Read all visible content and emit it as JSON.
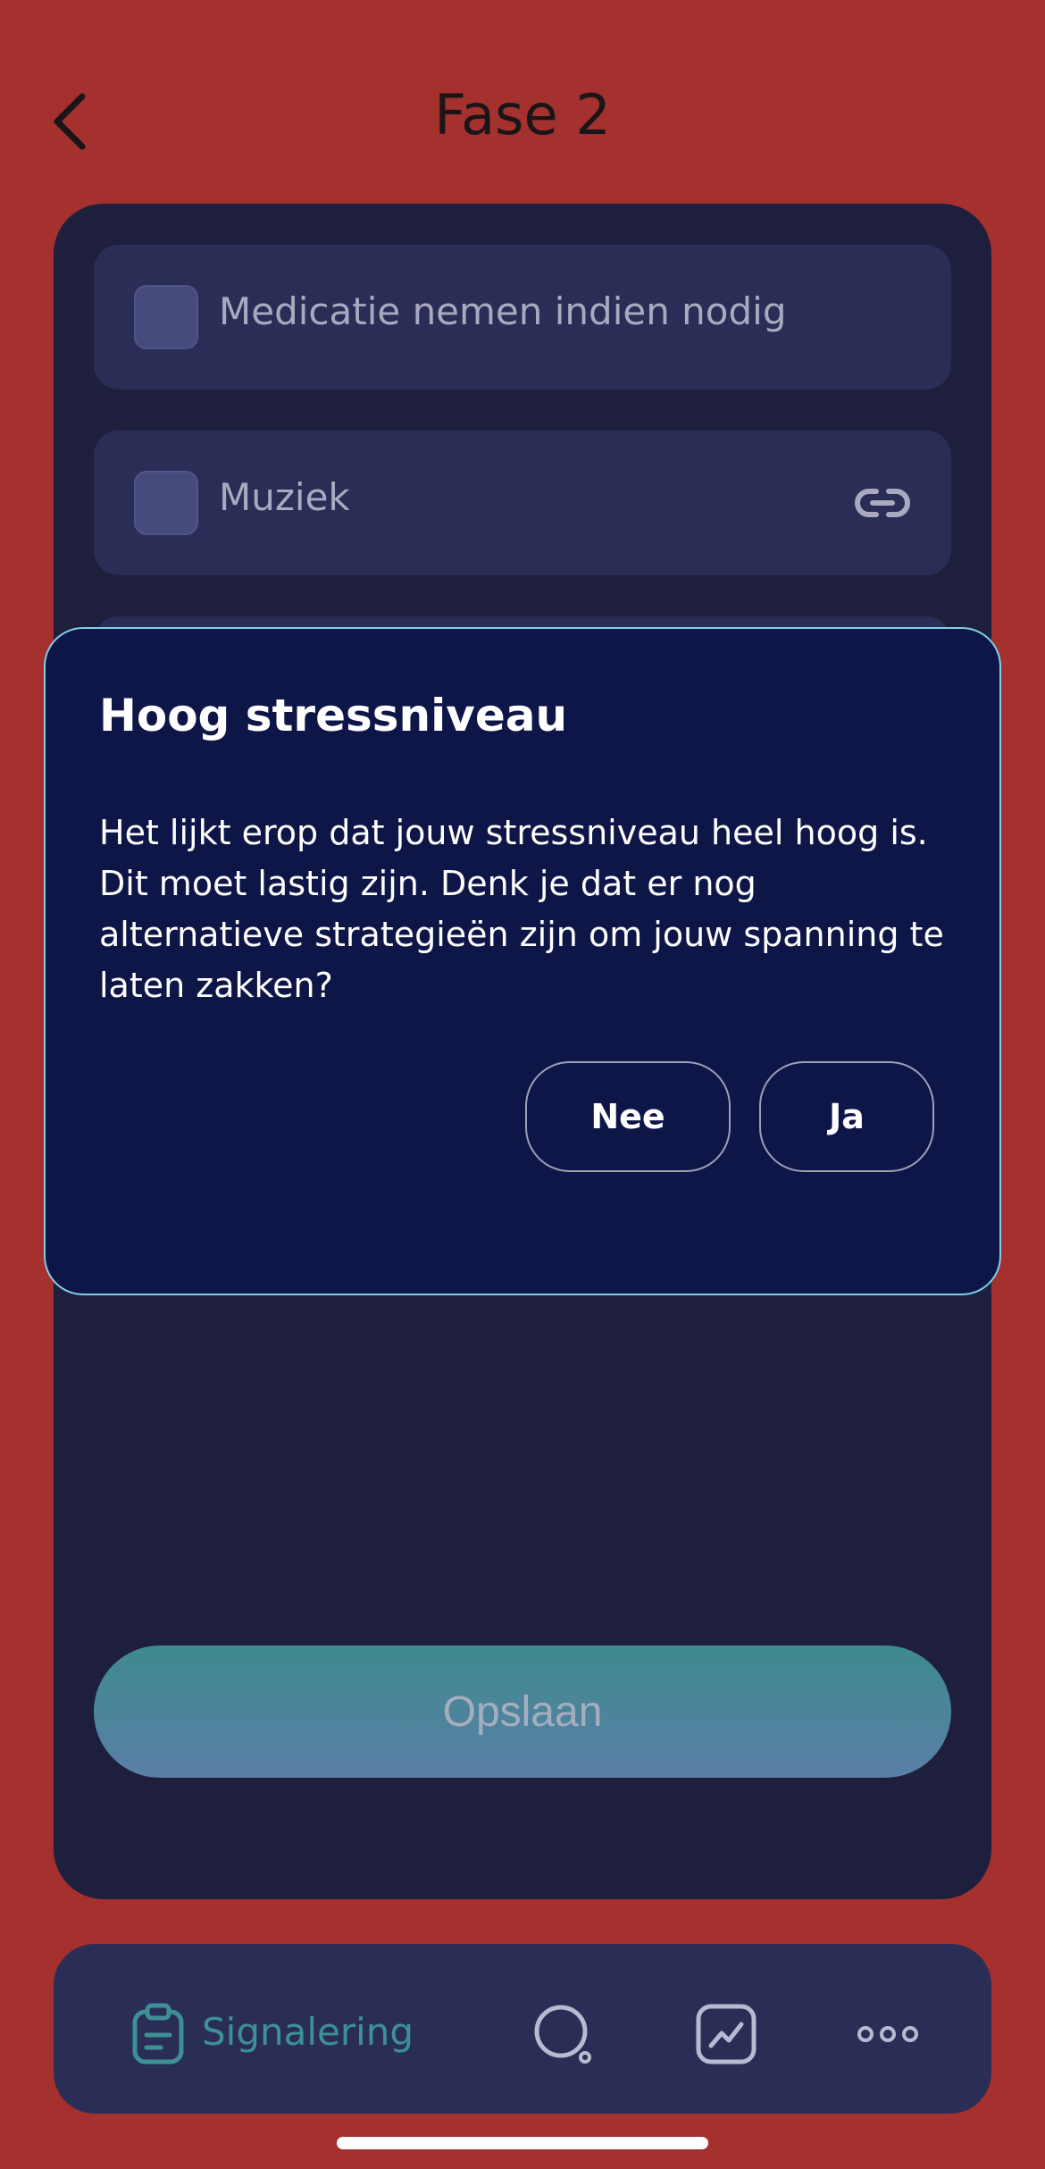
{
  "header": {
    "title": "Fase 2"
  },
  "items": [
    {
      "label": "Medicatie nemen indien nodig",
      "checked": false
    },
    {
      "label": "Muziek",
      "checked": false,
      "icon": "link-icon"
    }
  ],
  "save_label": "Opslaan",
  "dialog": {
    "title": "Hoog stressniveau",
    "message": "Het lijkt erop dat jouw stressniveau heel hoog is. Dit moet lastig zijn. Denk je dat er nog alternatieve strategieën zijn om jouw spanning te laten zakken?",
    "no_label": "Nee",
    "yes_label": "Ja"
  },
  "tabbar": {
    "active_label": "Signalering",
    "icons": [
      "clipboard-icon",
      "search-icon",
      "chart-icon",
      "more-icon"
    ]
  },
  "colors": {
    "background": "#a4312d",
    "card": "#1d1f3d",
    "item": "#2a2e56",
    "dialog": "#0e1648",
    "dialog_border": "#7fd0e6",
    "accent": "#3e9097"
  }
}
